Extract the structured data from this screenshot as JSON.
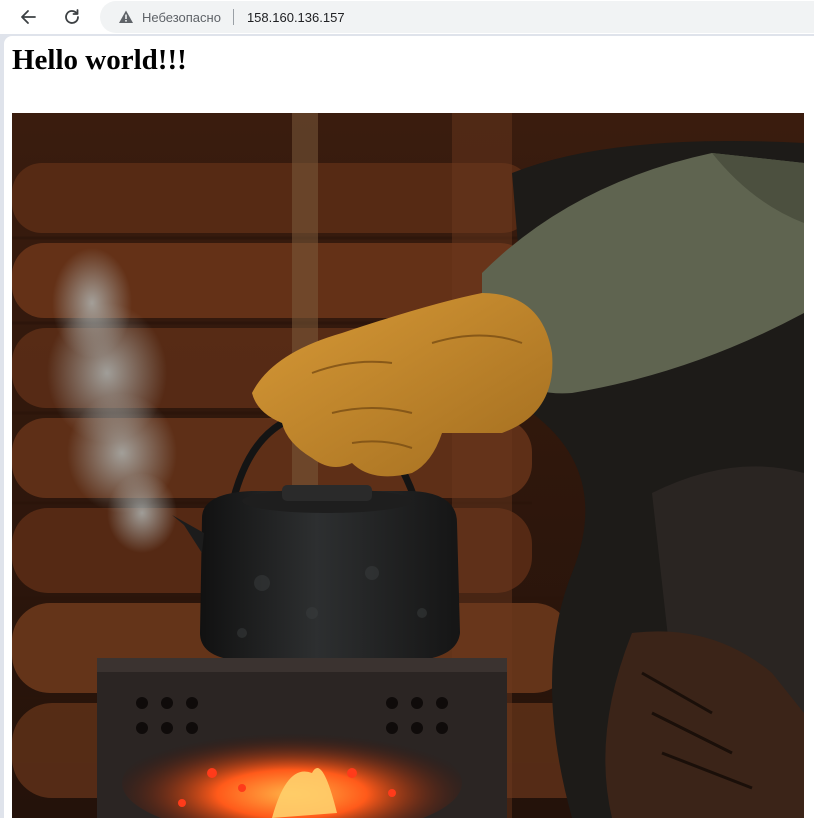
{
  "browser": {
    "security_label": "Небезопасно",
    "url": "158.160.136.157",
    "icons": {
      "back": "arrow-left-icon",
      "reload": "reload-icon",
      "security": "warning-triangle-icon"
    }
  },
  "page": {
    "heading": "Hello world!!!",
    "image": {
      "subject": "gloved hand lifting a black kettle from a camping stove with glowing embers, log wall background"
    },
    "colors": {
      "glove": "#c18a2c",
      "kettle": "#222222",
      "logs": "#5a2c15",
      "ember": "#ff5a1a"
    }
  }
}
